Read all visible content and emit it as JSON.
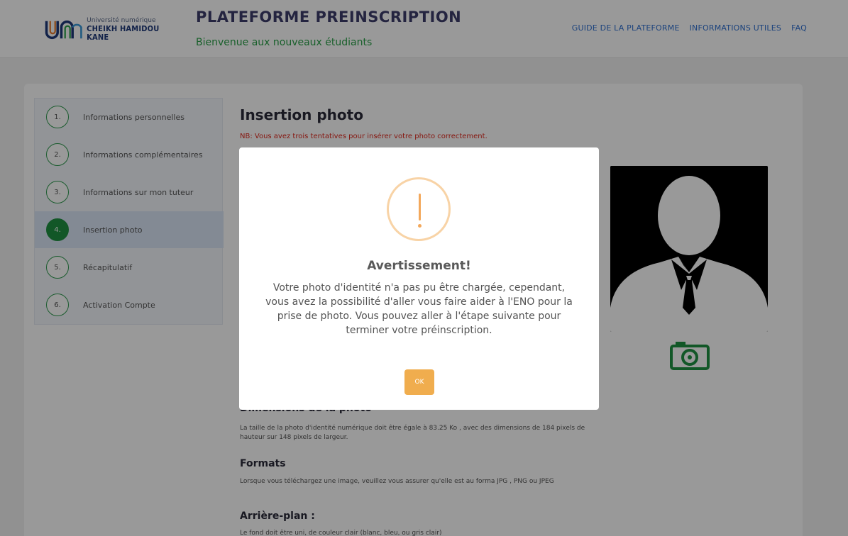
{
  "header": {
    "logo_small": "Université numérique",
    "logo_big": "CHEIKH HAMIDOU KANE",
    "title": "PLATEFORME PREINSCRIPTION",
    "subtitle": "Bienvenue aux nouveaux étudiants",
    "nav": [
      "GUIDE DE LA PLATEFORME",
      "INFORMATIONS UTILES",
      "FAQ"
    ]
  },
  "steps": [
    {
      "num": "1.",
      "label": "Informations personnelles",
      "active": false
    },
    {
      "num": "2.",
      "label": "Informations complémentaires",
      "active": false
    },
    {
      "num": "3.",
      "label": "Informations sur mon tuteur",
      "active": false
    },
    {
      "num": "4.",
      "label": "Insertion photo",
      "active": true
    },
    {
      "num": "5.",
      "label": "Récapitulatif",
      "active": false
    },
    {
      "num": "6.",
      "label": "Activation Compte",
      "active": false
    }
  ],
  "content": {
    "title": "Insertion photo",
    "nb": "NB: Vous avez trois tentatives pour insérer votre photo correctement.",
    "sections": [
      {
        "title": "Dimensions de la photo",
        "text": "La taille de la photo d'identité numérique doit être égale à 83.25 Ko , avec des dimensions de 184 pixels de hauteur sur 148 pixels de largeur."
      },
      {
        "title": "Formats",
        "text": "Lorsque vous téléchargez une image, veuillez vous assurer qu'elle est au forma JPG , PNG ou JPEG"
      },
      {
        "title": "Arrière-plan :",
        "text": "Le fond doit être uni, de couleur clair (blanc, bleu, ou gris clair)"
      }
    ]
  },
  "modal": {
    "icon": "exclamation-icon",
    "title": "Avertissement!",
    "body": "Votre photo d'identité n'a pas pu être chargée, cependant, vous avez la possibilité d'aller vous faire aider à l'ENO pour la prise de photo. Vous pouvez aller à l'étape suivante pour terminer votre préinscription.",
    "ok_label": "OK"
  },
  "colors": {
    "accent_green": "#1f9142",
    "warning_orange": "#f0ad4e",
    "nav_blue": "#2e6fd0",
    "nb_red": "#e0271c"
  }
}
